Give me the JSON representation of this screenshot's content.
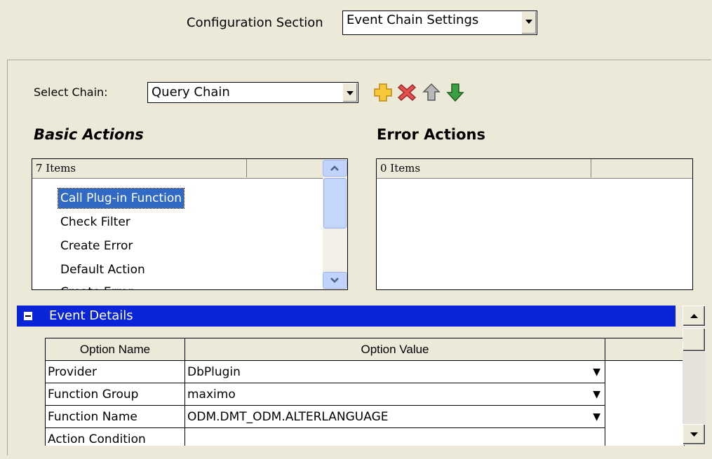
{
  "config": {
    "label": "Configuration Section",
    "selected": "Event Chain Settings"
  },
  "chain": {
    "label": "Select Chain:",
    "selected": "Query Chain",
    "toolbar": [
      "add-icon",
      "delete-icon",
      "move-up-icon",
      "move-down-icon"
    ]
  },
  "basic_actions": {
    "title": "Basic Actions",
    "count": "7 Items",
    "items": [
      "Call Plug-in Function",
      "Check Filter",
      "Create Error",
      "Default Action",
      "Create Error"
    ],
    "selected_index": 0
  },
  "error_actions": {
    "title": "Error Actions",
    "count": "0 Items",
    "items": []
  },
  "event_details": {
    "title": "Event Details",
    "columns": [
      "Option Name",
      "Option Value"
    ],
    "rows": [
      {
        "name": "Provider",
        "value": "DbPlugin"
      },
      {
        "name": "Function Group",
        "value": "maximo"
      },
      {
        "name": "Function Name",
        "value": "ODM.DMT_ODM.ALTERLANGUAGE"
      },
      {
        "name": "Action Condition",
        "value": ""
      }
    ]
  },
  "colors": {
    "background": "#ece9d8",
    "selection": "#316ac5",
    "event_bar": "#0a24d8",
    "add_icon": "#f7c83c",
    "delete_icon": "#e35050"
  }
}
